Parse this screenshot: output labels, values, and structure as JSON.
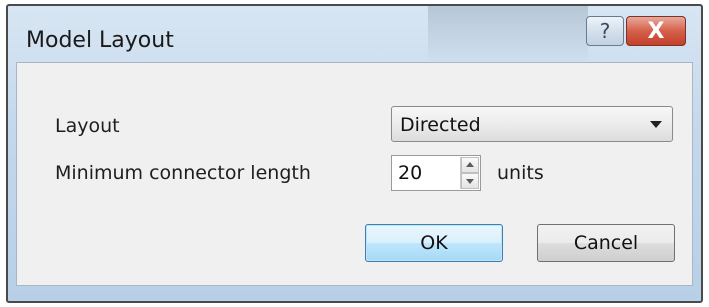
{
  "window": {
    "title": "Model Layout",
    "help_glyph": "?",
    "close_glyph": "X"
  },
  "form": {
    "layout_label": "Layout",
    "layout_value": "Directed",
    "min_length_label": "Minimum connector length",
    "min_length_value": "20",
    "units_label": "units"
  },
  "buttons": {
    "ok_label": "OK",
    "cancel_label": "Cancel"
  },
  "icons": {
    "help": "question-mark-icon",
    "close": "close-icon",
    "dropdown": "chevron-down-icon",
    "spin_up": "caret-up-icon",
    "spin_down": "caret-down-icon"
  },
  "colors": {
    "close_button": "#c2402b",
    "default_button_border": "#3c7fb1",
    "titlebar": "#c5d8ec"
  }
}
